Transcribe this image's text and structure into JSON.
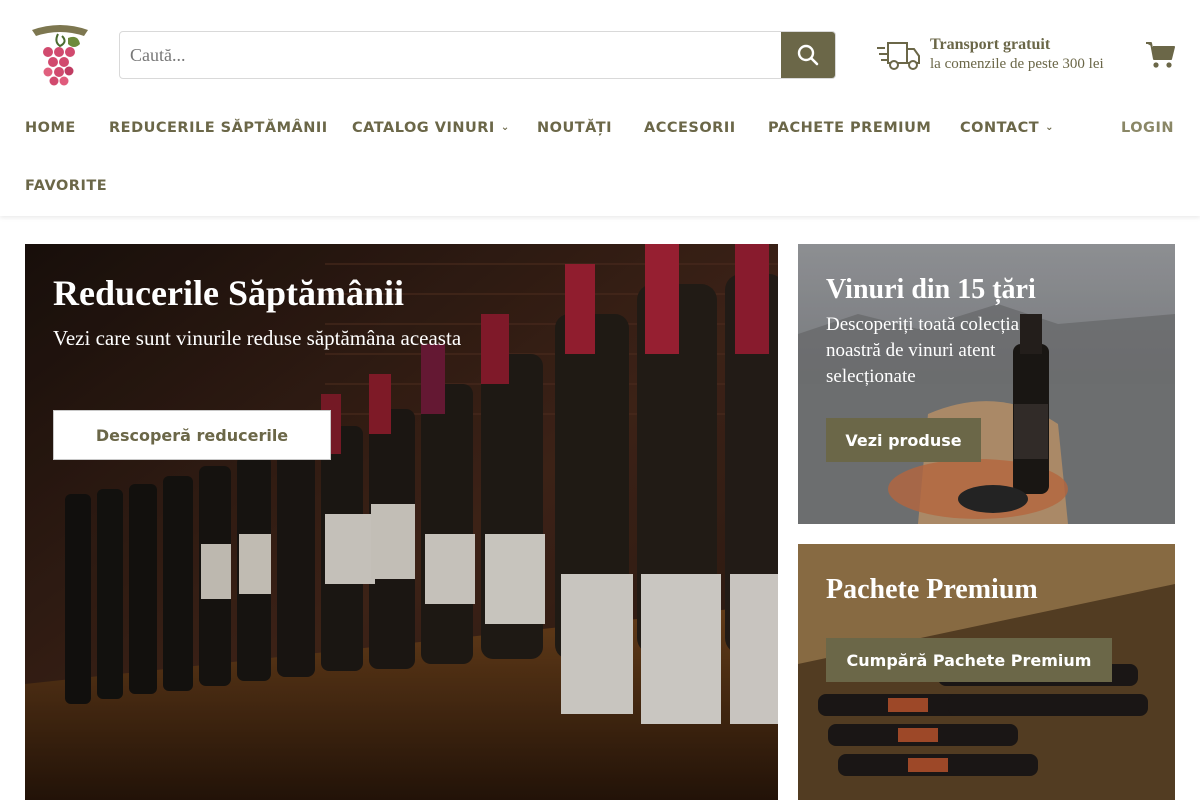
{
  "header": {
    "logo_alt": "Happy Wine",
    "search": {
      "placeholder": "Caută..."
    },
    "shipping": {
      "title": "Transport gratuit",
      "subtitle": "la comenzile de peste 300 lei"
    }
  },
  "nav": {
    "items": [
      {
        "label": "HOME"
      },
      {
        "label": "REDUCERILE SĂPTĂMÂNII"
      },
      {
        "label": "CATALOG VINURI",
        "dropdown": true
      },
      {
        "label": "NOUTĂȚI"
      },
      {
        "label": "ACCESORII"
      },
      {
        "label": "PACHETE PREMIUM"
      },
      {
        "label": "CONTACT",
        "dropdown": true
      },
      {
        "label": "FAVORITE"
      }
    ],
    "login": "LOGIN"
  },
  "tiles": {
    "main": {
      "title": "Reducerile Săptămânii",
      "subtitle": "Vezi care sunt vinurile reduse săptămâna aceasta",
      "button": "Descoperă reducerile"
    },
    "countries": {
      "title": "Vinuri din 15 țări",
      "subtitle": "Descoperiți toată colecția noastră de vinuri atent selecționate",
      "button": "Vezi produse"
    },
    "premium": {
      "title": "Pachete Premium",
      "button": "Cumpără Pachete Premium"
    }
  },
  "icons": {
    "logo": "grape-logo-icon",
    "search": "search-icon",
    "shipping": "truck-icon",
    "cart": "cart-icon",
    "dropdown": "chevron-down-icon"
  },
  "colors": {
    "accent": "#6b6748",
    "white": "#ffffff"
  }
}
